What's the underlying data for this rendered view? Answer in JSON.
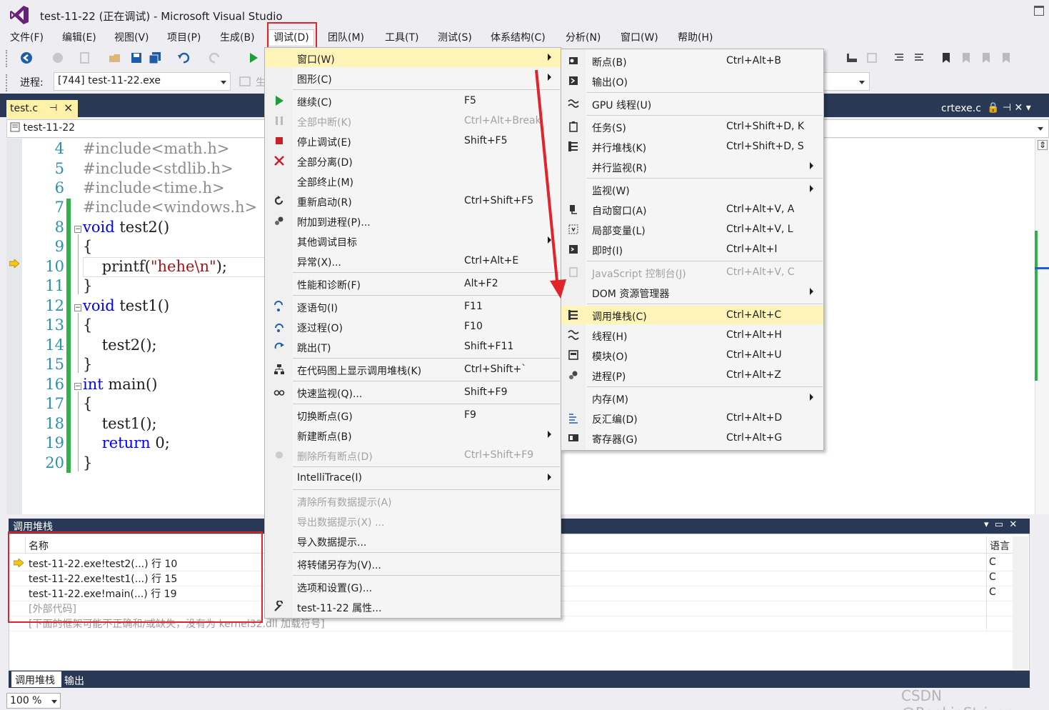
{
  "window": {
    "title": "test-11-22 (正在调试) - Microsoft Visual Studio"
  },
  "menubar": [
    {
      "label": "文件(F)"
    },
    {
      "label": "编辑(E)"
    },
    {
      "label": "视图(V)"
    },
    {
      "label": "项目(P)"
    },
    {
      "label": "生成(B)"
    },
    {
      "label": "调试(D)"
    },
    {
      "label": "团队(M)"
    },
    {
      "label": "工具(T)"
    },
    {
      "label": "测试(S)"
    },
    {
      "label": "体系结构(C)"
    },
    {
      "label": "分析(N)"
    },
    {
      "label": "窗口(W)"
    },
    {
      "label": "帮助(H)"
    }
  ],
  "toolbar": {
    "process_label": "进程:",
    "process_value": "[744] test-11-22.exe",
    "partial_label": "生"
  },
  "tabs": {
    "active": "test.c",
    "right": "crtexe.c"
  },
  "nav": {
    "scope": "test-11-22"
  },
  "editor": {
    "lines": [
      {
        "num": "4",
        "parts": [
          {
            "t": "#include<math.h>",
            "c": "pp"
          }
        ]
      },
      {
        "num": "5",
        "parts": [
          {
            "t": "#include<stdlib.h>",
            "c": "pp"
          }
        ]
      },
      {
        "num": "6",
        "parts": [
          {
            "t": "#include<time.h>",
            "c": "pp"
          }
        ]
      },
      {
        "num": "7",
        "parts": [
          {
            "t": "#include<windows.h>",
            "c": "pp"
          }
        ]
      },
      {
        "num": "8",
        "parts": [
          {
            "t": "void",
            "c": "kw"
          },
          {
            "t": " test2()",
            "c": ""
          }
        ]
      },
      {
        "num": "9",
        "parts": [
          {
            "t": "{",
            "c": ""
          }
        ]
      },
      {
        "num": "10",
        "parts": [
          {
            "t": "    printf(",
            "c": ""
          },
          {
            "t": "\"hehe\\n\"",
            "c": "str"
          },
          {
            "t": ");",
            "c": ""
          }
        ]
      },
      {
        "num": "11",
        "parts": [
          {
            "t": "}",
            "c": ""
          }
        ]
      },
      {
        "num": "12",
        "parts": [
          {
            "t": "void",
            "c": "kw"
          },
          {
            "t": " test1()",
            "c": ""
          }
        ]
      },
      {
        "num": "13",
        "parts": [
          {
            "t": "{",
            "c": ""
          }
        ]
      },
      {
        "num": "14",
        "parts": [
          {
            "t": "    test2();",
            "c": ""
          }
        ]
      },
      {
        "num": "15",
        "parts": [
          {
            "t": "}",
            "c": ""
          }
        ]
      },
      {
        "num": "16",
        "parts": [
          {
            "t": "int",
            "c": "kw"
          },
          {
            "t": " main()",
            "c": ""
          }
        ]
      },
      {
        "num": "17",
        "parts": [
          {
            "t": "{",
            "c": ""
          }
        ]
      },
      {
        "num": "18",
        "parts": [
          {
            "t": "    test1();",
            "c": ""
          }
        ]
      },
      {
        "num": "19",
        "parts": [
          {
            "t": "    ",
            "c": ""
          },
          {
            "t": "return",
            "c": "kw"
          },
          {
            "t": " 0;",
            "c": ""
          }
        ]
      },
      {
        "num": "20",
        "parts": [
          {
            "t": "}",
            "c": ""
          }
        ]
      }
    ]
  },
  "debug_menu": [
    {
      "label": "窗口(W)",
      "shortcut": "",
      "submenu": true,
      "disabled": false,
      "icon": ""
    },
    {
      "label": "图形(C)",
      "shortcut": "",
      "submenu": true,
      "disabled": false,
      "icon": ""
    },
    {
      "sep": true
    },
    {
      "label": "继续(C)",
      "shortcut": "F5",
      "submenu": false,
      "disabled": false,
      "icon": "play-icon"
    },
    {
      "label": "全部中断(K)",
      "shortcut": "Ctrl+Alt+Break",
      "submenu": false,
      "disabled": true,
      "icon": "pause-icon"
    },
    {
      "label": "停止调试(E)",
      "shortcut": "Shift+F5",
      "submenu": false,
      "disabled": false,
      "icon": "stop-icon"
    },
    {
      "label": "全部分离(D)",
      "shortcut": "",
      "submenu": false,
      "disabled": false,
      "icon": "detach-icon"
    },
    {
      "label": "全部终止(M)",
      "shortcut": "",
      "submenu": false,
      "disabled": false,
      "icon": ""
    },
    {
      "label": "重新启动(R)",
      "shortcut": "Ctrl+Shift+F5",
      "submenu": false,
      "disabled": false,
      "icon": "restart-icon"
    },
    {
      "label": "附加到进程(P)...",
      "shortcut": "",
      "submenu": false,
      "disabled": false,
      "icon": "gears-icon"
    },
    {
      "label": "其他调试目标",
      "shortcut": "",
      "submenu": true,
      "disabled": false,
      "icon": ""
    },
    {
      "label": "异常(X)...",
      "shortcut": "Ctrl+Alt+E",
      "submenu": false,
      "disabled": false,
      "icon": ""
    },
    {
      "sep": true
    },
    {
      "label": "性能和诊断(F)",
      "shortcut": "Alt+F2",
      "submenu": false,
      "disabled": false,
      "icon": ""
    },
    {
      "sep": true
    },
    {
      "label": "逐语句(I)",
      "shortcut": "F11",
      "submenu": false,
      "disabled": false,
      "icon": "step-into-icon"
    },
    {
      "label": "逐过程(O)",
      "shortcut": "F10",
      "submenu": false,
      "disabled": false,
      "icon": "step-over-icon"
    },
    {
      "label": "跳出(T)",
      "shortcut": "Shift+F11",
      "submenu": false,
      "disabled": false,
      "icon": "step-out-icon"
    },
    {
      "sep": true
    },
    {
      "label": "在代码图上显示调用堆栈(K)",
      "shortcut": "Ctrl+Shift+`",
      "submenu": false,
      "disabled": false,
      "icon": "code-map-icon"
    },
    {
      "sep": true
    },
    {
      "label": "快速监视(Q)...",
      "shortcut": "Shift+F9",
      "submenu": false,
      "disabled": false,
      "icon": "glasses-icon"
    },
    {
      "sep": true
    },
    {
      "label": "切换断点(G)",
      "shortcut": "F9",
      "submenu": false,
      "disabled": false,
      "icon": ""
    },
    {
      "label": "新建断点(B)",
      "shortcut": "",
      "submenu": true,
      "disabled": false,
      "icon": ""
    },
    {
      "label": "删除所有断点(D)",
      "shortcut": "Ctrl+Shift+F9",
      "submenu": false,
      "disabled": true,
      "icon": "delete-breakpoints-icon"
    },
    {
      "sep": true
    },
    {
      "label": "IntelliTrace(I)",
      "shortcut": "",
      "submenu": true,
      "disabled": false,
      "icon": ""
    },
    {
      "sep": true
    },
    {
      "label": "清除所有数据提示(A)",
      "shortcut": "",
      "submenu": false,
      "disabled": true,
      "icon": ""
    },
    {
      "label": "导出数据提示(X) ...",
      "shortcut": "",
      "submenu": false,
      "disabled": true,
      "icon": ""
    },
    {
      "label": "导入数据提示...",
      "shortcut": "",
      "submenu": false,
      "disabled": false,
      "icon": ""
    },
    {
      "sep": true
    },
    {
      "label": "将转储另存为(V)...",
      "shortcut": "",
      "submenu": false,
      "disabled": false,
      "icon": ""
    },
    {
      "sep": true
    },
    {
      "label": "选项和设置(G)...",
      "shortcut": "",
      "submenu": false,
      "disabled": false,
      "icon": ""
    },
    {
      "label": "test-11-22 属性...",
      "shortcut": "",
      "submenu": false,
      "disabled": false,
      "icon": "wrench-icon"
    }
  ],
  "window_submenu": [
    {
      "label": "断点(B)",
      "shortcut": "Ctrl+Alt+B",
      "submenu": false,
      "disabled": false,
      "icon": "breakpoints-icon"
    },
    {
      "label": "输出(O)",
      "shortcut": "",
      "submenu": false,
      "disabled": false,
      "icon": "output-icon"
    },
    {
      "sep": true
    },
    {
      "label": "GPU 线程(U)",
      "shortcut": "",
      "submenu": false,
      "disabled": false,
      "icon": "gpu-threads-icon"
    },
    {
      "sep": true
    },
    {
      "label": "任务(S)",
      "shortcut": "Ctrl+Shift+D, K",
      "submenu": false,
      "disabled": false,
      "icon": "tasks-icon"
    },
    {
      "label": "并行堆栈(K)",
      "shortcut": "Ctrl+Shift+D, S",
      "submenu": false,
      "disabled": false,
      "icon": "parallel-stacks-icon"
    },
    {
      "label": "并行监视(R)",
      "shortcut": "",
      "submenu": true,
      "disabled": false,
      "icon": ""
    },
    {
      "sep": true
    },
    {
      "label": "监视(W)",
      "shortcut": "",
      "submenu": true,
      "disabled": false,
      "icon": ""
    },
    {
      "label": "自动窗口(A)",
      "shortcut": "Ctrl+Alt+V, A",
      "submenu": false,
      "disabled": false,
      "icon": "autos-icon"
    },
    {
      "label": "局部变量(L)",
      "shortcut": "Ctrl+Alt+V, L",
      "submenu": false,
      "disabled": false,
      "icon": "locals-icon"
    },
    {
      "label": "即时(I)",
      "shortcut": "Ctrl+Alt+I",
      "submenu": false,
      "disabled": false,
      "icon": "immediate-icon"
    },
    {
      "sep": true
    },
    {
      "label": "JavaScript 控制台(J)",
      "shortcut": "Ctrl+Alt+V, C",
      "submenu": false,
      "disabled": true,
      "icon": "js-console-icon"
    },
    {
      "label": "DOM 资源管理器",
      "shortcut": "",
      "submenu": true,
      "disabled": false,
      "icon": ""
    },
    {
      "sep": true
    },
    {
      "label": "调用堆栈(C)",
      "shortcut": "Ctrl+Alt+C",
      "submenu": false,
      "disabled": false,
      "icon": "call-stack-icon",
      "hover": true
    },
    {
      "label": "线程(H)",
      "shortcut": "Ctrl+Alt+H",
      "submenu": false,
      "disabled": false,
      "icon": "threads-icon"
    },
    {
      "label": "模块(O)",
      "shortcut": "Ctrl+Alt+U",
      "submenu": false,
      "disabled": false,
      "icon": "modules-icon"
    },
    {
      "label": "进程(P)",
      "shortcut": "Ctrl+Alt+Z",
      "submenu": false,
      "disabled": false,
      "icon": "processes-icon"
    },
    {
      "sep": true
    },
    {
      "label": "内存(M)",
      "shortcut": "",
      "submenu": true,
      "disabled": false,
      "icon": ""
    },
    {
      "label": "反汇编(D)",
      "shortcut": "Ctrl+Alt+D",
      "submenu": false,
      "disabled": false,
      "icon": "disassembly-icon"
    },
    {
      "label": "寄存器(G)",
      "shortcut": "Ctrl+Alt+G",
      "submenu": false,
      "disabled": false,
      "icon": "registers-icon"
    }
  ],
  "callstack": {
    "title": "调用堆栈",
    "col_name": "名称",
    "col_lang": "语言",
    "rows": [
      {
        "name": "test-11-22.exe!test2(...) 行 10",
        "lang": "C",
        "current": true
      },
      {
        "name": "test-11-22.exe!test1(...) 行 15",
        "lang": "C",
        "current": false
      },
      {
        "name": "test-11-22.exe!main(...) 行 19",
        "lang": "C",
        "current": false
      },
      {
        "name": "[外部代码]",
        "lang": "",
        "current": false
      },
      {
        "name": "[下面的框架可能不正确和/或缺失，没有为 kernel32.dll 加载符号]",
        "lang": "",
        "current": false
      }
    ]
  },
  "bottom_tabs": {
    "active": "调用堆栈",
    "other": "输出"
  },
  "status": {
    "zoom": "100 %"
  },
  "watermark": "CSDN @RookieStriver",
  "colors": {
    "highlight_box": "#e0242b",
    "menu_hover": "#fff4b8",
    "tab_strip": "#293955",
    "line_numbers": "#2b91af",
    "change_bar": "#2fb24b"
  }
}
